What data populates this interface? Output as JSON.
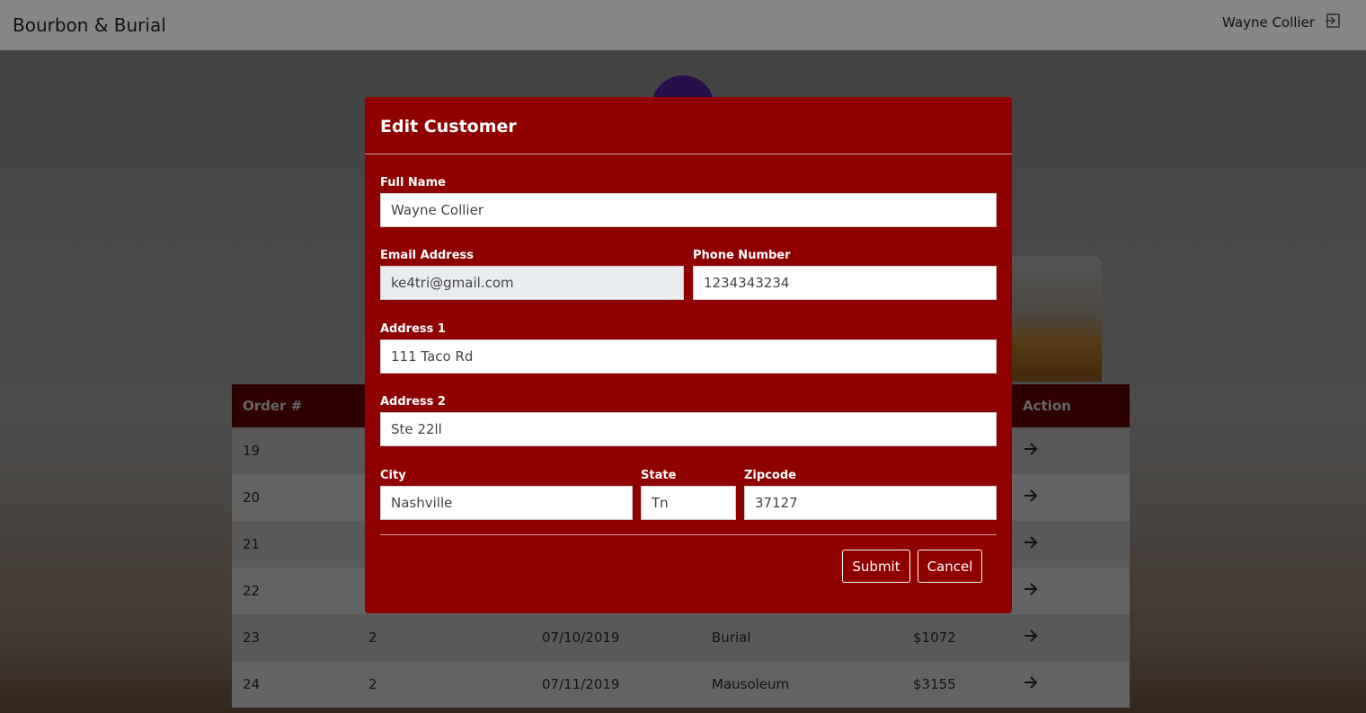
{
  "navbar": {
    "brand": "Bourbon & Burial",
    "user": "Wayne Collier",
    "logout_icon": "logout-icon"
  },
  "orders_table": {
    "headers": [
      "Order #",
      "",
      "",
      "",
      "",
      "Action"
    ],
    "rows": [
      [
        "19",
        "",
        "",
        "",
        ""
      ],
      [
        "20",
        "",
        "",
        "",
        ""
      ],
      [
        "21",
        "",
        "",
        "",
        ""
      ],
      [
        "22",
        "",
        "",
        "",
        ""
      ],
      [
        "23",
        "2",
        "07/10/2019",
        "Burial",
        "$1072"
      ],
      [
        "24",
        "2",
        "07/11/2019",
        "Mausoleum",
        "$3155"
      ]
    ],
    "row_action_icon": "arrow-right-icon"
  },
  "modal": {
    "title": "Edit Customer",
    "full_name": {
      "label": "Full Name",
      "value": "Wayne Collier"
    },
    "email": {
      "label": "Email Address",
      "value": "ke4tri@gmail.com"
    },
    "phone": {
      "label": "Phone Number",
      "value": "1234343234"
    },
    "address1": {
      "label": "Address 1",
      "value": "111 Taco Rd"
    },
    "address2": {
      "label": "Address 2",
      "value": "Ste 22ll"
    },
    "city": {
      "label": "City",
      "value": "Nashville"
    },
    "state": {
      "label": "State",
      "value": "Tn"
    },
    "zipcode": {
      "label": "Zipcode",
      "value": "37127"
    },
    "submit_label": "Submit",
    "cancel_label": "Cancel"
  },
  "colors": {
    "modal_bg": "#8f0000",
    "table_header": "#560000",
    "avatar": "#4a1c8a"
  }
}
